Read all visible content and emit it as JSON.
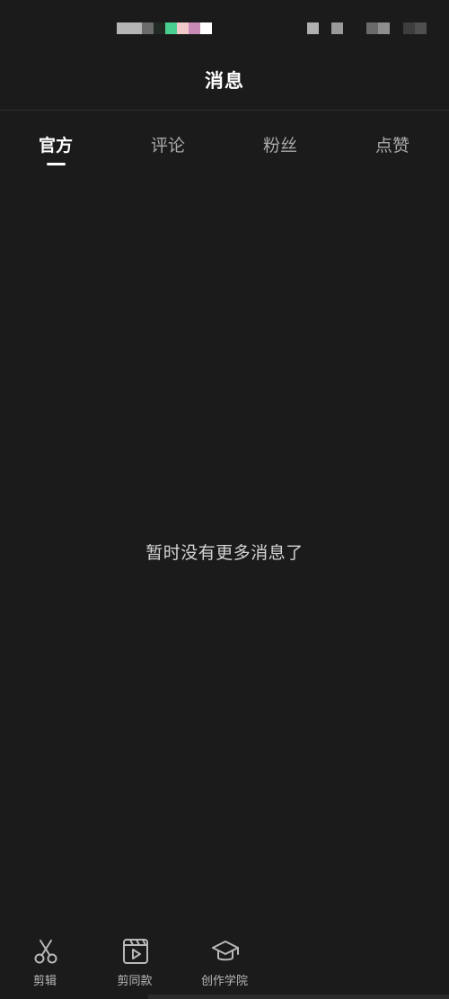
{
  "header": {
    "title": "消息"
  },
  "tabs": [
    {
      "label": "官方",
      "active": true
    },
    {
      "label": "评论",
      "active": false
    },
    {
      "label": "粉丝",
      "active": false
    },
    {
      "label": "点赞",
      "active": false
    }
  ],
  "empty_state": {
    "text": "暂时没有更多消息了"
  },
  "bottom_nav": {
    "items": [
      {
        "label": "剪辑",
        "icon": "scissors-icon"
      },
      {
        "label": "剪同款",
        "icon": "video-template-icon"
      },
      {
        "label": "创作学院",
        "icon": "graduation-cap-icon"
      }
    ]
  },
  "colors": {
    "background": "#1b1b1b",
    "title": "#ffffff",
    "tab_inactive": "#a9a9a9",
    "tab_active": "#ffffff",
    "divider": "#2f2f2f",
    "nav_label": "#b8b8b8"
  }
}
